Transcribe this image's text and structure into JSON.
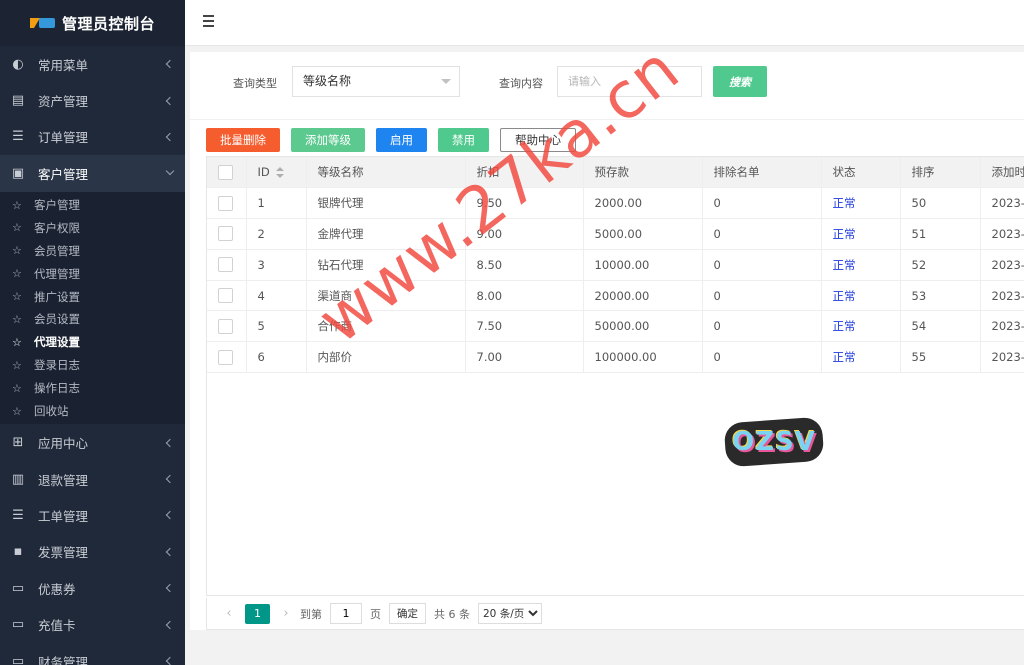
{
  "sidebar": {
    "title": "管理员控制台",
    "items": [
      {
        "label": "常用菜单",
        "icon": "dashboard-icon"
      },
      {
        "label": "资产管理",
        "icon": "server-icon"
      },
      {
        "label": "订单管理",
        "icon": "list-icon"
      },
      {
        "label": "客户管理",
        "icon": "id-card-icon"
      },
      {
        "label": "应用中心",
        "icon": "windows-icon"
      },
      {
        "label": "退款管理",
        "icon": "money-icon"
      },
      {
        "label": "工单管理",
        "icon": "list-icon"
      },
      {
        "label": "发票管理",
        "icon": "invoice-icon"
      },
      {
        "label": "优惠券",
        "icon": "card-icon"
      },
      {
        "label": "充值卡",
        "icon": "card-icon"
      },
      {
        "label": "财务管理",
        "icon": "card-icon"
      }
    ],
    "subitems": [
      "客户管理",
      "客户权限",
      "会员管理",
      "代理管理",
      "推广设置",
      "会员设置",
      "代理设置",
      "登录日志",
      "操作日志",
      "回收站"
    ]
  },
  "search": {
    "type_label": "查询类型",
    "type_value": "等级名称",
    "content_label": "查询内容",
    "content_placeholder": "请输入",
    "button_label": "搜索"
  },
  "toolbar": {
    "batch_delete": "批量删除",
    "add_level": "添加等级",
    "enable": "启用",
    "disable": "禁用",
    "help": "帮助中心"
  },
  "table": {
    "headers": [
      "ID",
      "等级名称",
      "折扣",
      "预存款",
      "排除名单",
      "状态",
      "排序",
      "添加时"
    ],
    "rows": [
      {
        "id": "1",
        "name": "银牌代理",
        "discount": "9.50",
        "deposit": "2000.00",
        "exclude": "0",
        "status": "正常",
        "sort": "50",
        "added": "2023-"
      },
      {
        "id": "2",
        "name": "金牌代理",
        "discount": "9.00",
        "deposit": "5000.00",
        "exclude": "0",
        "status": "正常",
        "sort": "51",
        "added": "2023-"
      },
      {
        "id": "3",
        "name": "钻石代理",
        "discount": "8.50",
        "deposit": "10000.00",
        "exclude": "0",
        "status": "正常",
        "sort": "52",
        "added": "2023-"
      },
      {
        "id": "4",
        "name": "渠道商",
        "discount": "8.00",
        "deposit": "20000.00",
        "exclude": "0",
        "status": "正常",
        "sort": "53",
        "added": "2023-"
      },
      {
        "id": "5",
        "name": "合作商",
        "discount": "7.50",
        "deposit": "50000.00",
        "exclude": "0",
        "status": "正常",
        "sort": "54",
        "added": "2023-"
      },
      {
        "id": "6",
        "name": "内部价",
        "discount": "7.00",
        "deposit": "100000.00",
        "exclude": "0",
        "status": "正常",
        "sort": "55",
        "added": "2023-"
      }
    ]
  },
  "pager": {
    "current": "1",
    "goto_label": "到第",
    "goto_value": "1",
    "page_label": "页",
    "confirm": "确定",
    "total": "共 6 条",
    "per_page": "20 条/页"
  },
  "overlay": {
    "watermark": "www.27ka.cn",
    "sticker": "OZSV"
  },
  "colors": {
    "sidebar_bg": "#20293a",
    "primary_green": "#4fc98e",
    "danger": "#f55d2f",
    "info_blue": "#1e84f0",
    "status_blue": "#1e3ae0",
    "pager_current": "#009688"
  }
}
